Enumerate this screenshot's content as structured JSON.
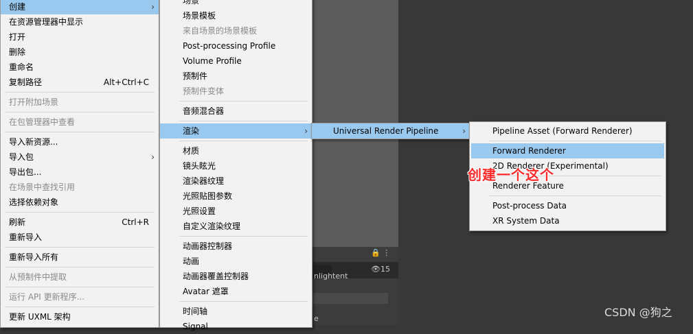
{
  "colors": {
    "highlight": "#99c9ef",
    "menu_bg": "#f2f2f2",
    "annotation": "#ff2a2a",
    "editor_bg": "#383838"
  },
  "menu_level1": {
    "items": [
      {
        "label": "创建",
        "submenu": true,
        "highlighted": true
      },
      {
        "label": "在资源管理器中显示"
      },
      {
        "label": "打开"
      },
      {
        "label": "删除"
      },
      {
        "label": "重命名"
      },
      {
        "label": "复制路径",
        "shortcut": "Alt+Ctrl+C"
      },
      {
        "label": "打开附加场景",
        "disabled": true
      },
      {
        "label": "在包管理器中查看",
        "disabled": true
      },
      {
        "label": "导入新资源..."
      },
      {
        "label": "导入包",
        "submenu": true
      },
      {
        "label": "导出包..."
      },
      {
        "label": "在场景中查找引用",
        "disabled": true
      },
      {
        "label": "选择依赖对象"
      },
      {
        "label": "刷新",
        "shortcut": "Ctrl+R"
      },
      {
        "label": "重新导入"
      },
      {
        "label": "重新导入所有"
      },
      {
        "label": "从预制件中提取",
        "disabled": true
      },
      {
        "label": "运行 API 更新程序...",
        "disabled": true
      },
      {
        "label": "更新 UXML 架构"
      }
    ]
  },
  "menu_level2": {
    "items": [
      {
        "label": "场景"
      },
      {
        "label": "场景模板"
      },
      {
        "label": "来自场景的场景模板",
        "disabled": true
      },
      {
        "label": "Post-processing Profile"
      },
      {
        "label": "Volume Profile"
      },
      {
        "label": "预制件"
      },
      {
        "label": "预制件变体",
        "disabled": true
      },
      {
        "label": "音频混合器"
      },
      {
        "label": "渲染",
        "submenu": true,
        "highlighted": true
      },
      {
        "label": "材质"
      },
      {
        "label": "镜头眩光"
      },
      {
        "label": "渲染器纹理"
      },
      {
        "label": "光照贴图参数"
      },
      {
        "label": "光照设置"
      },
      {
        "label": "自定义渲染纹理"
      },
      {
        "label": "动画器控制器"
      },
      {
        "label": "动画"
      },
      {
        "label": "动画器覆盖控制器"
      },
      {
        "label": "Avatar 遮罩"
      },
      {
        "label": "时间轴"
      },
      {
        "label": "Signal"
      }
    ]
  },
  "menu_level3": {
    "items": [
      {
        "label": "Universal Render Pipeline",
        "submenu": true,
        "highlighted": true
      }
    ]
  },
  "menu_level4": {
    "items": [
      {
        "label": "Pipeline Asset (Forward Renderer)"
      },
      {
        "label": "Forward Renderer",
        "highlighted": true
      },
      {
        "label": "2D Renderer (Experimental)"
      },
      {
        "label": "Renderer Feature"
      },
      {
        "label": "Post-process Data"
      },
      {
        "label": "XR System Data"
      }
    ]
  },
  "annotation": {
    "text": "创建一个这个"
  },
  "watermark": {
    "text": "CSDN @狗之"
  },
  "background_panel": {
    "count": "15",
    "partial_text_1": "nlightent",
    "partial_text_2": "e"
  }
}
